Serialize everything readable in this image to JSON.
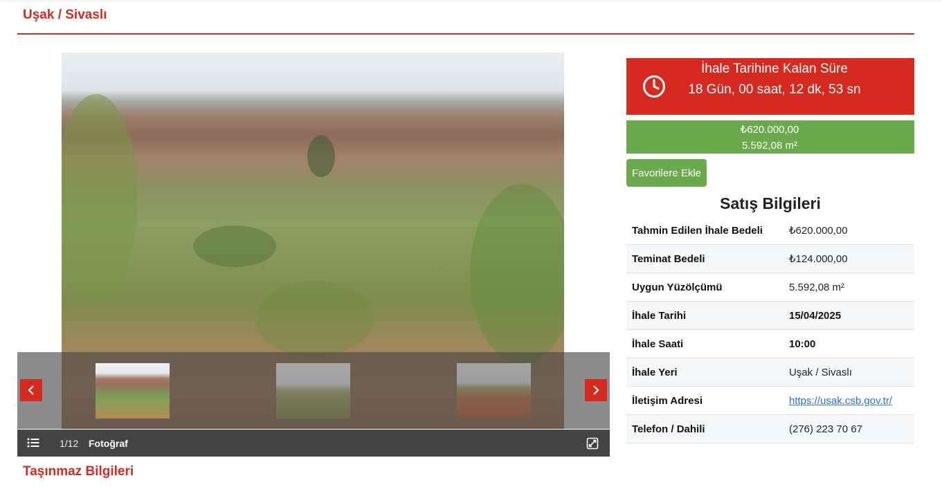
{
  "page": {
    "title": "Uşak / Sivaslı",
    "section_title": "Taşınmaz Bilgileri"
  },
  "gallery": {
    "counter": "1/12",
    "media_label": "Fotoğraf",
    "icons": {
      "prev": "chevron-left-icon",
      "next": "chevron-right-icon",
      "list": "list-icon",
      "expand": "expand-icon"
    }
  },
  "countdown": {
    "title": "İhale Tarihine Kalan Süre",
    "time": "18 Gün, 00 saat, 12 dk, 53 sn",
    "icon": "clock-icon"
  },
  "price": {
    "amount": "₺620.000,00",
    "area": "5.592,08 m²"
  },
  "favorites_label": "Favorilere Ekle",
  "sales_info": {
    "title": "Satış Bilgileri",
    "rows": [
      {
        "label": "Tahmin Edilen İhale Bedeli",
        "value": "₺620.000,00"
      },
      {
        "label": "Teminat Bedeli",
        "value": "₺124.000,00"
      },
      {
        "label": "Uygun Yüzölçümü",
        "value": "5.592,08 m²"
      },
      {
        "label": "İhale Tarihi",
        "value": "15/04/2025"
      },
      {
        "label": "İhale Saati",
        "value": "10:00"
      },
      {
        "label": "İhale Yeri",
        "value": "Uşak / Sivaslı"
      },
      {
        "label": "İletişim Adresi",
        "value": "https://usak.csb.gov.tr/"
      },
      {
        "label": "Telefon / Dahili",
        "value": "(276) 223 70 67"
      }
    ]
  },
  "colors": {
    "accent_red": "#d62a21",
    "green": "#6aaa4c",
    "link": "#2a6fd6",
    "gallery_bar": "#444444"
  }
}
